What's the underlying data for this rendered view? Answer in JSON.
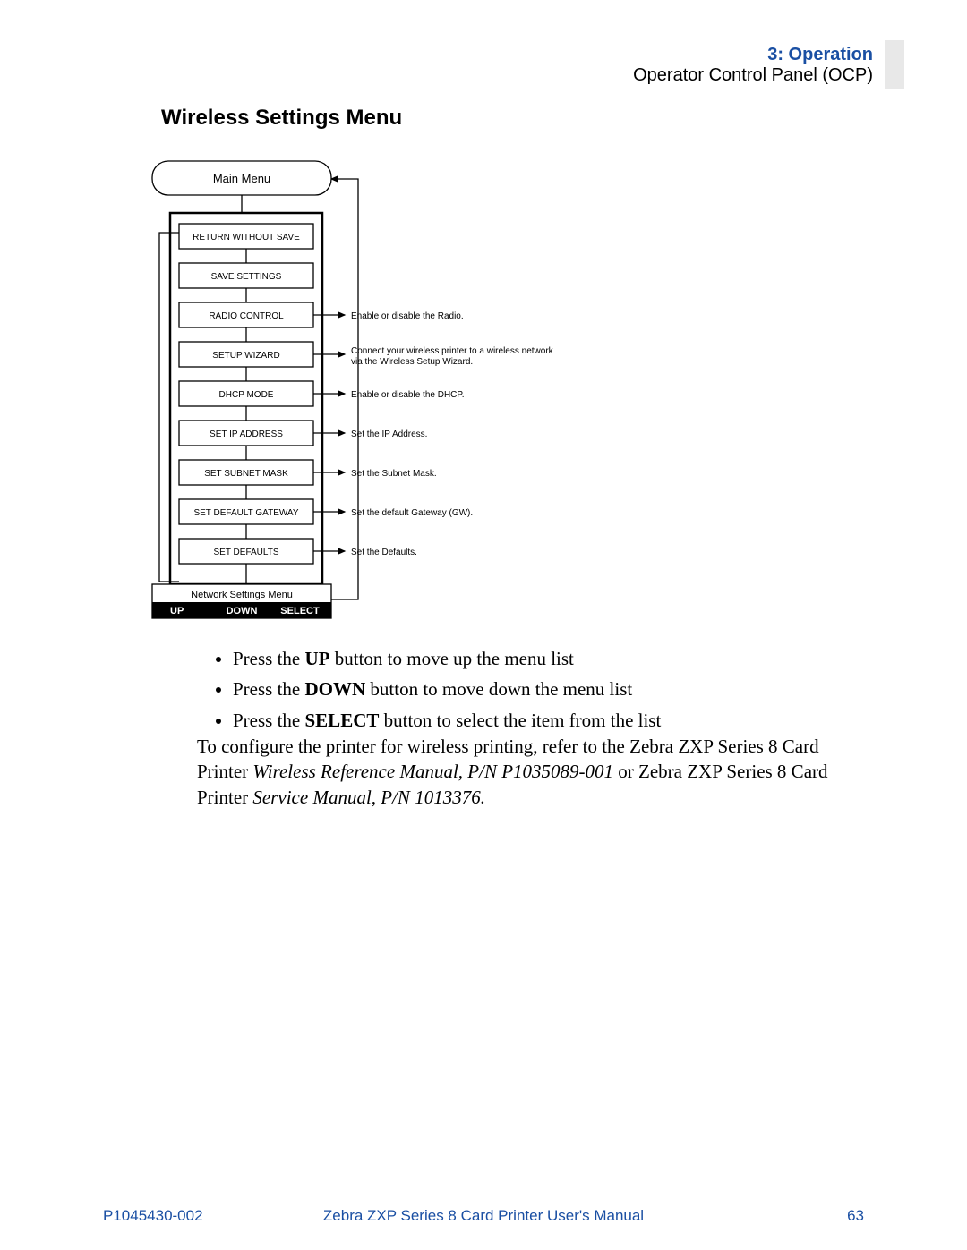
{
  "header": {
    "chapter": "3: Operation",
    "section": "Operator Control Panel (OCP)"
  },
  "title": "Wireless Settings Menu",
  "diagram": {
    "top_node": "Main Menu",
    "frame_items": [
      {
        "label": "RETURN WITHOUT SAVE",
        "desc": ""
      },
      {
        "label": "SAVE SETTINGS",
        "desc": ""
      },
      {
        "label": "RADIO CONTROL",
        "desc": "Enable or disable the Radio."
      },
      {
        "label": "SETUP WIZARD",
        "desc": "Connect your wireless printer to a wireless network via the Wireless Setup Wizard."
      },
      {
        "label": "DHCP MODE",
        "desc": "Enable or disable the DHCP."
      },
      {
        "label": "SET IP ADDRESS",
        "desc": "Set the IP Address."
      },
      {
        "label": "SET SUBNET MASK",
        "desc": "Set the Subnet Mask."
      },
      {
        "label": "SET DEFAULT GATEWAY",
        "desc": "Set the default Gateway (GW)."
      },
      {
        "label": "SET DEFAULTS",
        "desc": "Set the Defaults."
      }
    ],
    "bottom_label": "Network Settings Menu",
    "buttons": {
      "up": "UP",
      "down": "DOWN",
      "select": "SELECT"
    }
  },
  "bullets": {
    "b1_pre": "Press the ",
    "b1_bold": "UP",
    "b1_post": " button to move up the menu list",
    "b2_pre": "Press the ",
    "b2_bold": "DOWN",
    "b2_post": " button to move down the menu list",
    "b3_pre": "Press the ",
    "b3_bold": "SELECT",
    "b3_post": " button to select the item from the list"
  },
  "paragraph": {
    "p1": "To configure the printer for wireless printing, refer to the Zebra ZXP Series 8 Card Printer ",
    "p2_italic": "Wireless Reference Manual, P/N P1035089-001",
    "p3": " or Zebra ZXP Series 8 Card Printer ",
    "p4_italic": "Service Manual, P/N 1013376."
  },
  "footer": {
    "left": "P1045430-002",
    "center": "Zebra ZXP Series 8 Card Printer User's Manual",
    "right": "63"
  }
}
